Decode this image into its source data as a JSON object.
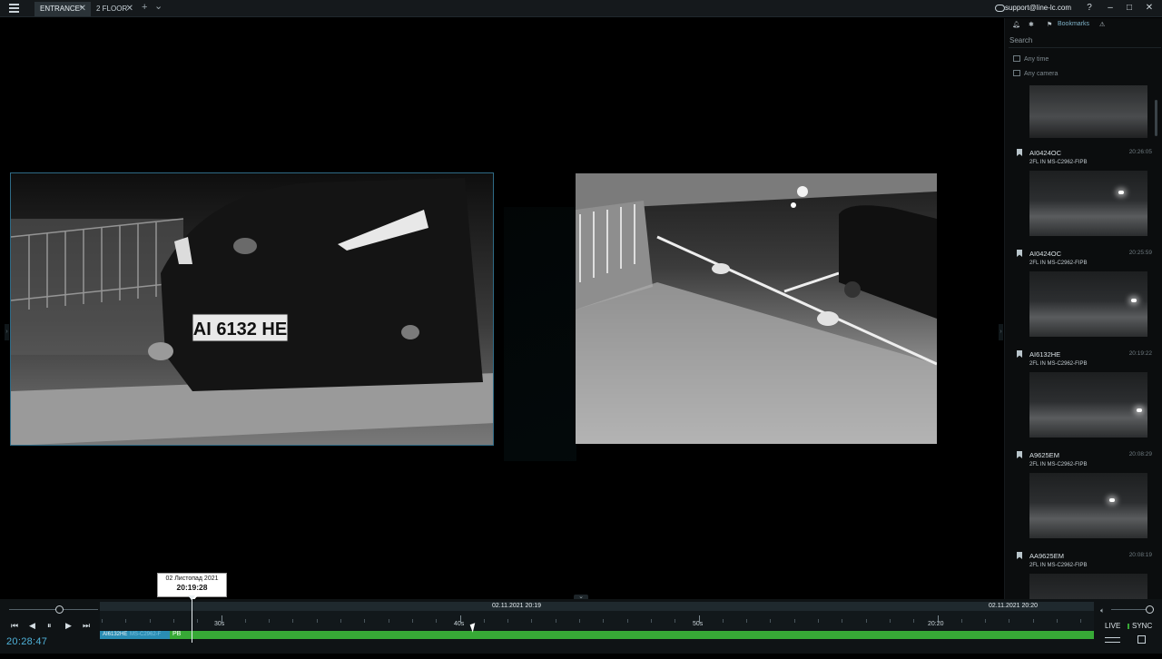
{
  "tabs": [
    {
      "label": "ENTRANCE*",
      "close": "✕",
      "active": true
    },
    {
      "label": "2 FLOOR",
      "close": "✕",
      "active": false
    }
  ],
  "topbar": {
    "add_symbol": "+",
    "dropdown_symbol": "⌄",
    "support_email": "support@line-lc.com",
    "help": "?",
    "minimize": "–",
    "maximize": "□",
    "close": "✕"
  },
  "side_panel": {
    "tab_bookmarks": "Bookmarks",
    "search_placeholder": "Search",
    "filter_time": "Any time",
    "filter_camera": "Any camera",
    "bookmarks": [
      {
        "plate": "AI0424OC",
        "time": "20:26:05",
        "camera": "2FL IN MS-C2962-FIPB"
      },
      {
        "plate": "AI0424OC",
        "time": "20:25:59",
        "camera": "2FL IN MS-C2962-FIPB"
      },
      {
        "plate": "AI6132HE",
        "time": "20:19:22",
        "camera": "2FL IN MS-C2962-FIPB"
      },
      {
        "plate": "A9625EM",
        "time": "20:08:29",
        "camera": "2FL IN MS-C2962-FIPB"
      },
      {
        "plate": "AA9625EM",
        "time": "20:08:19",
        "camera": "2FL IN MS-C2962-FIPB"
      }
    ]
  },
  "camera1": {
    "plate_text": "AI 6132 HE"
  },
  "tooltip": {
    "date": "02 Листопад 2021",
    "time": "20:19:28"
  },
  "timeline": {
    "zoom_minus": "−",
    "zoom_plus": "+",
    "header_left": "02.11.2021 20:19",
    "header_right": "02.11.2021 20:20",
    "major_labels": [
      "30s",
      "40s",
      "50s",
      "20:20"
    ],
    "track_label": "AI6132HE",
    "track_label_ghost": "MS-C2962-F",
    "track_suffix": "PB",
    "current_time": "20:28:47",
    "live_label": "LIVE",
    "sync_label": "SYNC"
  },
  "transport": {
    "skip_back": "⏮",
    "step_back": "◀",
    "pause": "⏸",
    "step_forward": "▶",
    "skip_forward": "⏭"
  },
  "colors": {
    "accent": "#4fb2d9",
    "track_green": "#37a936",
    "track_blue": "#2a8db4",
    "frame_border": "#2f6b86"
  }
}
